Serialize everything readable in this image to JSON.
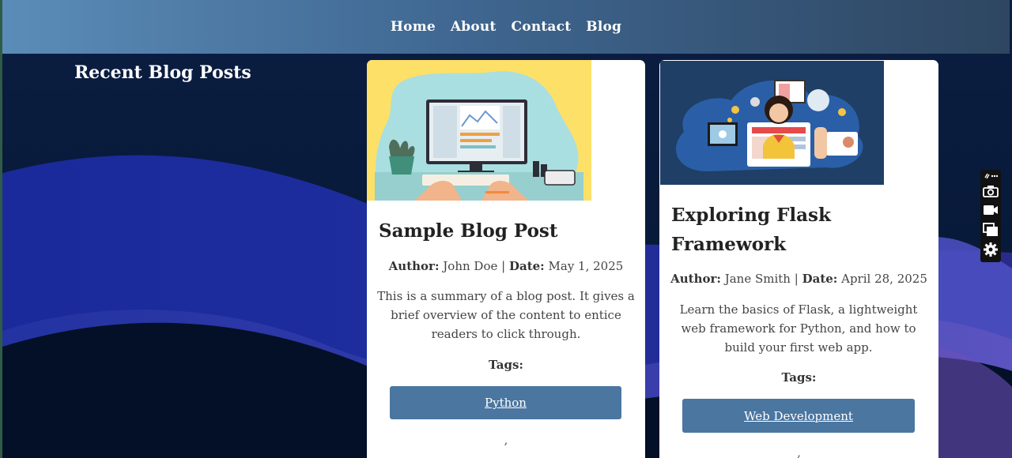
{
  "nav": {
    "items": [
      "Home",
      "About",
      "Contact",
      "Blog"
    ]
  },
  "page_title": "Recent Blog Posts",
  "posts": [
    {
      "title": "Sample Blog Post",
      "author_label": "Author:",
      "author": "John Doe",
      "separator": "|",
      "date_label": "Date:",
      "date": "May 1, 2025",
      "summary": "This is a summary of a blog post. It gives a brief overview of the content to entice readers to click through.",
      "tags_label": "Tags:",
      "tags": [
        "Python"
      ],
      "trailing": ","
    },
    {
      "title": "Exploring Flask Framework",
      "author_label": "Author:",
      "author": "Jane Smith",
      "separator": "|",
      "date_label": "Date:",
      "date": "April 28, 2025",
      "summary": "Learn the basics of Flask, a lightweight web framework for Python, and how to build your first web app.",
      "tags_label": "Tags:",
      "tags": [
        "Web Development"
      ],
      "trailing": ","
    }
  ],
  "toolbar": {
    "icons": [
      "link-more-icon",
      "camera-icon",
      "video-icon",
      "windows-icon",
      "gear-icon"
    ]
  },
  "colors": {
    "nav_start": "#5b8cb8",
    "nav_end": "#2e4661",
    "tag_button": "#4a76a0",
    "background": "#020d1f"
  }
}
